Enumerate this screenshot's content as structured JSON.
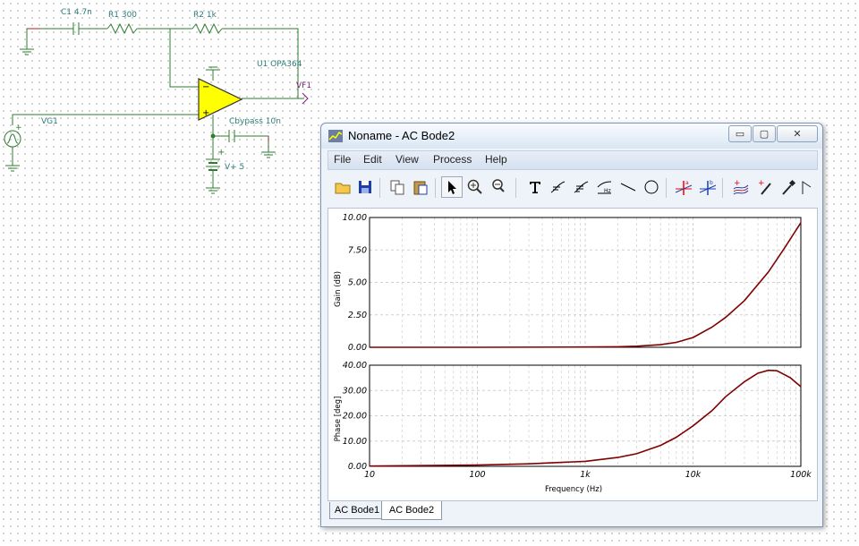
{
  "schematic": {
    "components": {
      "c1": "C1 4.7n",
      "r1": "R1 300",
      "r2": "R2 1k",
      "u1": "U1 OPA364",
      "vf1": "VF1",
      "vg1": "VG1",
      "cbypass": "Cbypass 10n",
      "vplus": "V+ 5"
    }
  },
  "window": {
    "title": "Noname - AC Bode2",
    "controls": {
      "minimize": "▭",
      "maximize": "▢",
      "close": "✕"
    },
    "menu": [
      "File",
      "Edit",
      "View",
      "Process",
      "Help"
    ],
    "toolbar_icons": [
      "open-folder-icon",
      "save-icon",
      "copy-icon",
      "paste-icon",
      "pointer-icon",
      "zoom-in-icon",
      "zoom-100-icon",
      "text-icon",
      "curve-label-icon",
      "curve-label2-icon",
      "axis-label-icon",
      "line-icon",
      "circle-icon",
      "cursor-a-icon",
      "cursor-b-icon",
      "add-curve-icon",
      "add-marker-icon",
      "pipette-icon",
      "angle-icon"
    ],
    "tabs": [
      {
        "label": "AC Bode1",
        "active": false
      },
      {
        "label": "AC Bode2",
        "active": true
      }
    ]
  },
  "chart_data": [
    {
      "type": "line",
      "ylabel": "Gain (dB)",
      "xscale": "log",
      "xlim": [
        10,
        100000
      ],
      "ylim": [
        0,
        10
      ],
      "yticks": [
        "10.00",
        "7.50",
        "5.00",
        "2.50",
        "0.00"
      ],
      "grid": true,
      "line_color": "#800000",
      "series": [
        {
          "x": [
            10,
            100,
            1000,
            2000,
            3000,
            5000,
            7000,
            10000,
            15000,
            20000,
            30000,
            50000,
            70000,
            100000
          ],
          "values": [
            0,
            0,
            0.02,
            0.04,
            0.08,
            0.2,
            0.38,
            0.75,
            1.55,
            2.3,
            3.6,
            5.8,
            7.6,
            9.6
          ]
        }
      ]
    },
    {
      "type": "line",
      "ylabel": "Phase [deg]",
      "xlabel": "Frequency (Hz)",
      "xscale": "log",
      "xlim": [
        10,
        100000
      ],
      "ylim": [
        0,
        40
      ],
      "yticks": [
        "40.00",
        "30.00",
        "20.00",
        "10.00",
        "0.00"
      ],
      "xticks": [
        "10",
        "100",
        "1k",
        "10k",
        "100k"
      ],
      "grid": true,
      "line_color": "#800000",
      "series": [
        {
          "x": [
            10,
            100,
            300,
            1000,
            2000,
            3000,
            5000,
            7000,
            10000,
            15000,
            20000,
            30000,
            40000,
            50000,
            60000,
            80000,
            100000
          ],
          "values": [
            0.1,
            0.5,
            1.0,
            2.0,
            3.5,
            5.0,
            8.3,
            11.5,
            16.0,
            22.0,
            27.5,
            33.5,
            36.8,
            38.0,
            37.8,
            35.0,
            31.5
          ]
        }
      ]
    }
  ]
}
